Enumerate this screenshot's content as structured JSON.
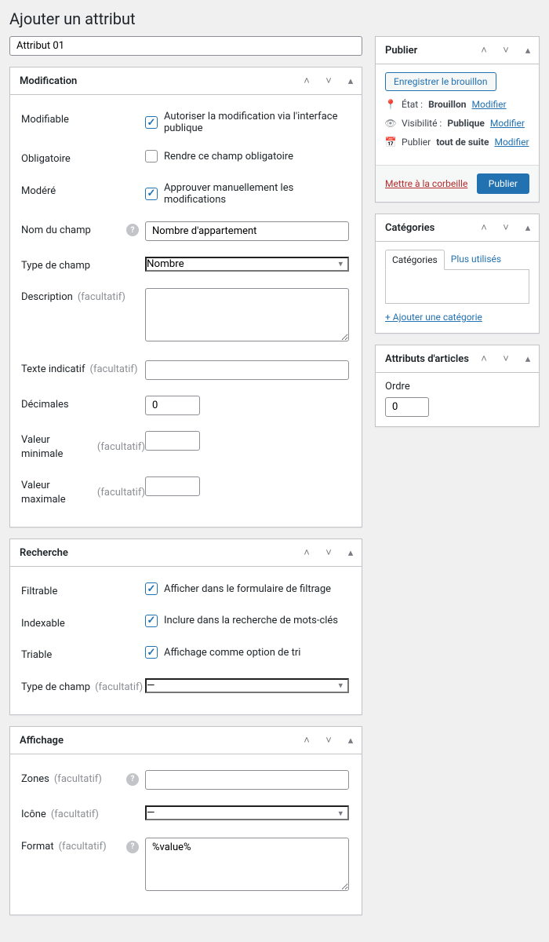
{
  "page": {
    "title": "Ajouter un attribut",
    "title_value": "Attribut 01"
  },
  "panels": {
    "modification": {
      "title": "Modification",
      "rows": {
        "modifiable": {
          "label": "Modifiable",
          "text": "Autoriser la modification via l'interface publique",
          "checked": true
        },
        "obligatoire": {
          "label": "Obligatoire",
          "text": "Rendre ce champ obligatoire",
          "checked": false
        },
        "modere": {
          "label": "Modéré",
          "text": "Approuver manuellement les modifications",
          "checked": true
        },
        "nom_champ": {
          "label": "Nom du champ",
          "value": "Nombre d'appartement"
        },
        "type_champ": {
          "label": "Type de champ",
          "value": "Nombre"
        },
        "description": {
          "label": "Description",
          "opt": "(facultatif)",
          "value": ""
        },
        "texte_indicatif": {
          "label": "Texte indicatif",
          "opt": "(facultatif)",
          "value": ""
        },
        "decimales": {
          "label": "Décimales",
          "value": "0"
        },
        "valeur_min": {
          "label": "Valeur minimale",
          "opt": "(facultatif)",
          "value": ""
        },
        "valeur_max": {
          "label": "Valeur maximale",
          "opt": "(facultatif)",
          "value": ""
        }
      }
    },
    "recherche": {
      "title": "Recherche",
      "rows": {
        "filtrable": {
          "label": "Filtrable",
          "text": "Afficher dans le formulaire de filtrage",
          "checked": true
        },
        "indexable": {
          "label": "Indexable",
          "text": "Inclure dans la recherche de mots-clés",
          "checked": true
        },
        "triable": {
          "label": "Triable",
          "text": "Affichage comme option de tri",
          "checked": true
        },
        "type_champ": {
          "label": "Type de champ",
          "opt": "(facultatif)",
          "value": "—"
        }
      }
    },
    "affichage": {
      "title": "Affichage",
      "rows": {
        "zones": {
          "label": "Zones",
          "opt": "(facultatif)",
          "value": ""
        },
        "icone": {
          "label": "Icône",
          "opt": "(facultatif)",
          "value": "—"
        },
        "format": {
          "label": "Format",
          "opt": "(facultatif)",
          "value": "%value%"
        }
      }
    }
  },
  "side": {
    "publier": {
      "title": "Publier",
      "save_draft": "Enregistrer le brouillon",
      "etat": {
        "label": "État :",
        "value": "Brouillon",
        "modify": "Modifier"
      },
      "visibilite": {
        "label": "Visibilité :",
        "value": "Publique",
        "modify": "Modifier"
      },
      "quand": {
        "label": "Publier",
        "value": "tout de suite",
        "modify": "Modifier"
      },
      "trash": "Mettre à la corbeille",
      "publish_btn": "Publier"
    },
    "categories": {
      "title": "Catégories",
      "tab_cat": "Catégories",
      "tab_plus": "Plus utilisés",
      "add": "+ Ajouter une catégorie"
    },
    "attributs": {
      "title": "Attributs d'articles",
      "ordre_label": "Ordre",
      "ordre_value": "0"
    }
  }
}
